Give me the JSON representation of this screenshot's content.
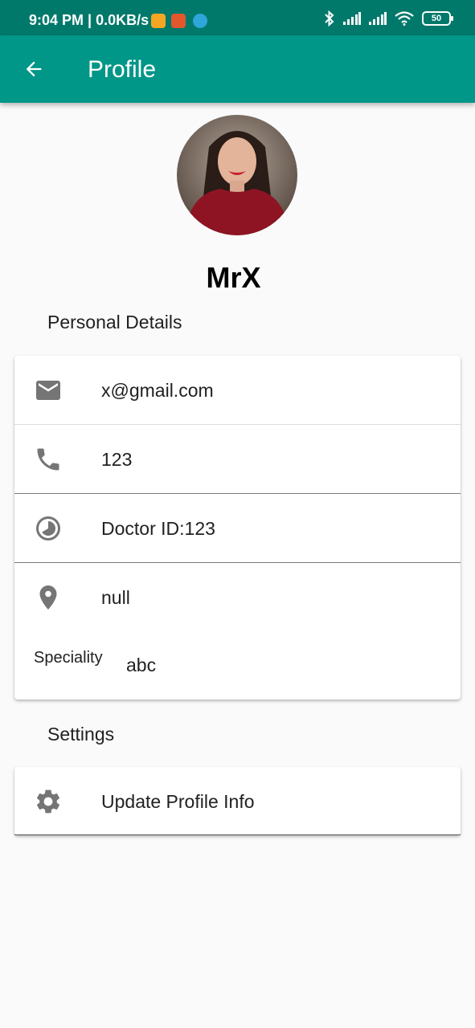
{
  "status_bar": {
    "time": "9:04 PM | 0.0KB/s",
    "battery": "50"
  },
  "app_bar": {
    "title": "Profile"
  },
  "profile": {
    "name": "MrX"
  },
  "personal_details": {
    "section_title": "Personal Details",
    "email": "x@gmail.com",
    "phone": "123",
    "doctor_id": "Doctor ID:123",
    "location": "null",
    "speciality_label": "Speciality",
    "speciality_value": "abc"
  },
  "settings": {
    "section_title": "Settings",
    "update_profile_label": "Update Profile Info"
  },
  "colors": {
    "status_bar": "#00796b",
    "app_bar": "#009688",
    "icon_gray": "#757575",
    "background": "#fafafa"
  }
}
